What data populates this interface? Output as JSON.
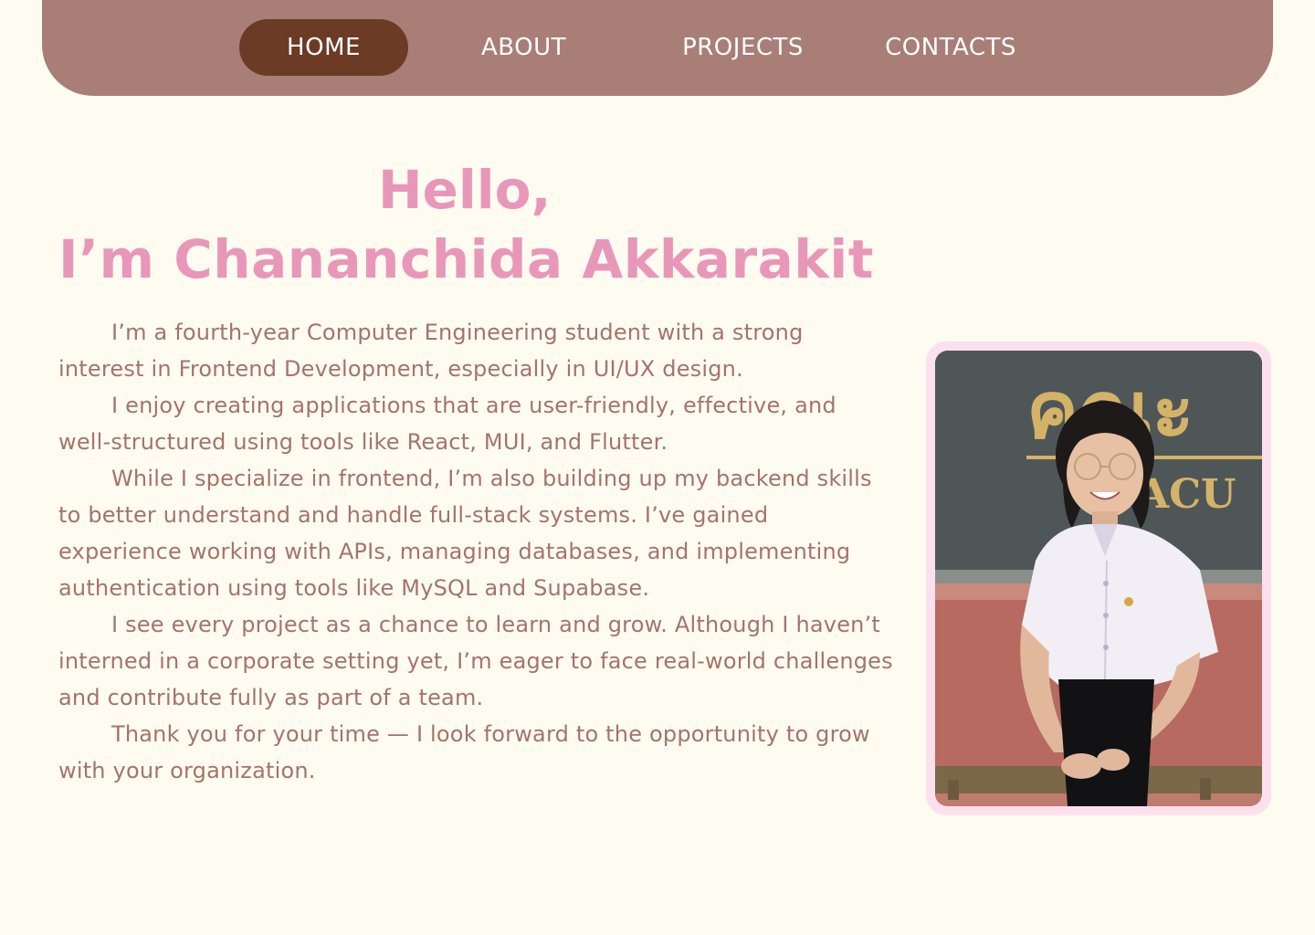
{
  "nav": {
    "items": [
      {
        "label": "HOME",
        "active": true
      },
      {
        "label": "ABOUT",
        "active": false
      },
      {
        "label": "PROJECTS",
        "active": false
      },
      {
        "label": "CONTACTS",
        "active": false
      }
    ]
  },
  "hero": {
    "greeting": "Hello,",
    "name": "I’m Chananchida Akkarakit"
  },
  "bio": {
    "paragraphs": [
      "I’m a fourth-year Computer Engineering student with a strong interest in Frontend Development, especially in UI/UX design.",
      "I enjoy creating applications that are user-friendly, effective, and well-structured using tools like React, MUI, and Flutter.",
      "While I specialize in frontend, I’m also building up my backend skills to better understand and handle full-stack systems. I’ve gained experience working with APIs, managing databases, and implementing authentication using tools like MySQL and Supabase.",
      "I see every project as a chance to learn and grow. Although I haven’t interned in a corporate setting yet, I’m eager to face real-world challenges and contribute fully as part of a team.",
      "Thank you for your time — I look forward to the opportunity to grow with your organization."
    ]
  },
  "photo": {
    "sign_text_thai": "คณะ",
    "sign_text_latin": "ACU"
  },
  "colors": {
    "background": "#fefcf0",
    "nav_bg": "#a87e76",
    "nav_active": "#6b3b25",
    "heading": "#e897b9",
    "body_text": "#a5736b",
    "photo_frame": "#fde0ee"
  }
}
